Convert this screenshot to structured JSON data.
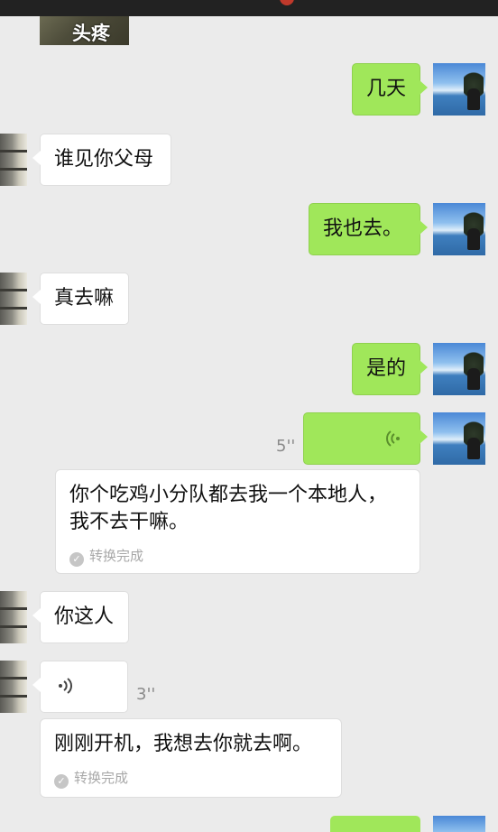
{
  "sticker": {
    "caption": "头疼"
  },
  "messages": [
    {
      "side": "right",
      "text": "几天"
    },
    {
      "side": "left",
      "text": "谁见你父母"
    },
    {
      "side": "right",
      "text": "我也去。"
    },
    {
      "side": "left",
      "text": "真去嘛"
    },
    {
      "side": "right",
      "text": "是的"
    },
    {
      "side": "right",
      "type": "voice",
      "duration": "5''",
      "transcript": "你个吃鸡小分队都去我一个本地人，\n我不去干嘛。",
      "status": "转换完成"
    },
    {
      "side": "left",
      "text": "你这人"
    },
    {
      "side": "left",
      "type": "voice",
      "duration": "3''",
      "transcript": "刚刚开机，我想去你就去啊。",
      "status": "转换完成"
    }
  ],
  "colors": {
    "sent_bubble": "#a0e75a",
    "received_bubble": "#ffffff",
    "background": "#ebebeb"
  },
  "icons": {
    "voice": "voice-wave-icon",
    "check": "check-icon"
  }
}
